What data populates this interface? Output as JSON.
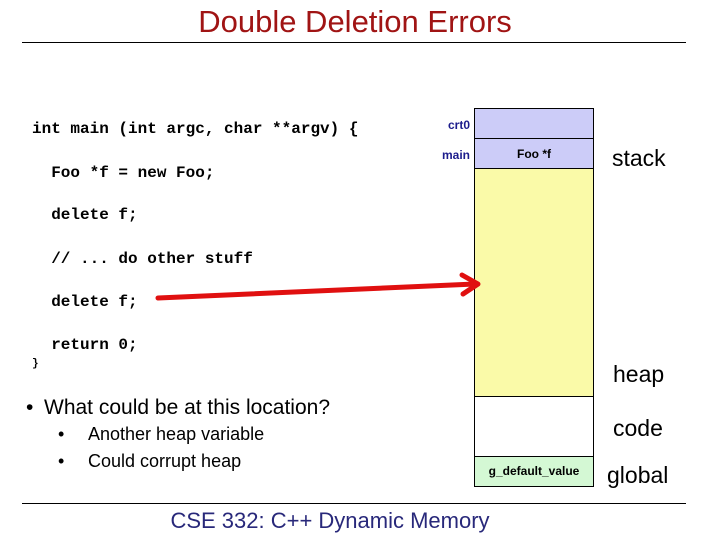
{
  "slide": {
    "title": "Double Deletion Errors",
    "footer": "CSE 332: C++ Dynamic Memory"
  },
  "code": [
    "int main (int argc, char **argv) {",
    "  Foo *f = new Foo;",
    "  delete f;",
    "  // ... do other stuff",
    "  delete f;",
    "  return 0;",
    "}"
  ],
  "bullets": {
    "main": "What could be at this location?",
    "sub": [
      "Another heap variable",
      "Could corrupt heap"
    ]
  },
  "memory": {
    "frames": [
      {
        "label": "crt0",
        "content": ""
      },
      {
        "label": "main",
        "content": "Foo *f"
      }
    ],
    "global_var": "g_default_value",
    "regions": [
      "stack",
      "heap",
      "code",
      "global"
    ],
    "colors": {
      "stack": "#ccccf8",
      "heap": "#fafaa8",
      "code": "#ffffff",
      "global": "#d4f8d4",
      "arrow": "#e01010"
    }
  }
}
